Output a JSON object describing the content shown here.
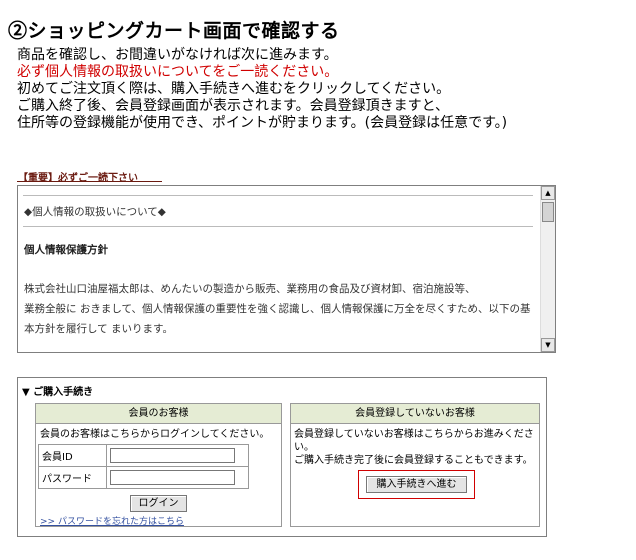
{
  "page_title": "②ショッピングカート画面で確認する",
  "intro": {
    "line1": "商品を確認し、お間違いがなければ次に進みます。",
    "line2_red": "必ず個人情報の取扱いについてをご一読ください。",
    "line3": "初めてご注文頂く際は、購入手続きへ進むをクリックしてください。",
    "line4": "ご購入終了後、会員登録画面が表示されます。会員登録頂きますと、",
    "line5": "住所等の登録機能が使用でき、ポイントが貯まります。(会員登録は任意です。)"
  },
  "notice_label": "【重要】必ずご一読下さい",
  "privacy": {
    "heading": "◆個人情報の取扱いについて◆",
    "policy_title": "個人情報保護方針",
    "body_lines": [
      "株式会社山口油屋福太郎は、めんたいの製造から販売、業務用の食品及び資材卸、宿泊施設等、",
      "業務全般に おきまして、個人情報保護の重要性を強く認識し、個人情報保護に万全を尽くすため、以下の基",
      "本方針を履行して まいります。"
    ]
  },
  "purchase": {
    "heading": "▼ ご購入手続き",
    "member": {
      "title": "会員のお客様",
      "desc": "会員のお客様はこちらからログインしてください。",
      "id_label": "会員ID",
      "password_label": "パスワード",
      "id_value": "",
      "password_value": "",
      "login_label": "ログイン",
      "forgot_link": ">> パスワードを忘れた方はこちら"
    },
    "guest": {
      "title": "会員登録していないお客様",
      "desc_line1": "会員登録していないお客様はこちらからお進みくださ",
      "desc_line2": "い。",
      "desc_line3": "ご購入手続き完了後に会員登録することもできます。",
      "proceed_label": "購入手続きへ進む"
    }
  },
  "colors": {
    "warning_red": "#d00000",
    "notice_brown": "#6b1a10",
    "section_header_bg": "#e5ecd4",
    "link_blue": "#3350a0"
  }
}
